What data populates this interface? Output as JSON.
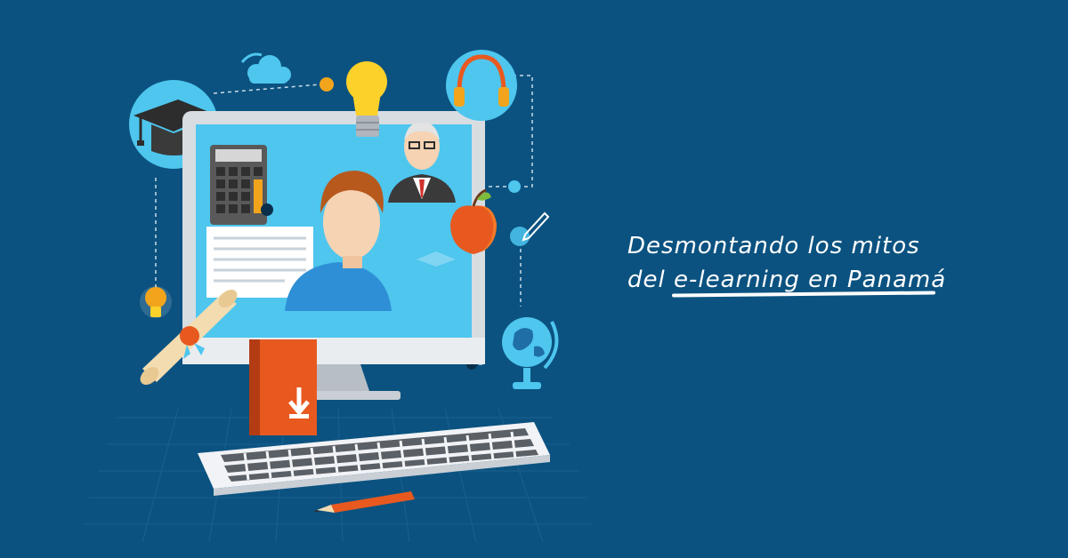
{
  "headline": {
    "line1": "Desmontando los mitos",
    "line2": "del e-learning en Panamá"
  },
  "colors": {
    "background": "#0b5280",
    "screen": "#4ec6ee",
    "accent_orange": "#e8591f",
    "keyboard": "#f1f3f6"
  },
  "icons": [
    "graduation-cap-icon",
    "cloud-icon",
    "lightbulb-icon",
    "headphones-icon",
    "calculator-icon",
    "teacher-avatar-icon",
    "student-avatar-icon",
    "apple-icon",
    "pencil-icon",
    "globe-icon",
    "diploma-icon",
    "book-download-icon",
    "keyboard-icon"
  ]
}
